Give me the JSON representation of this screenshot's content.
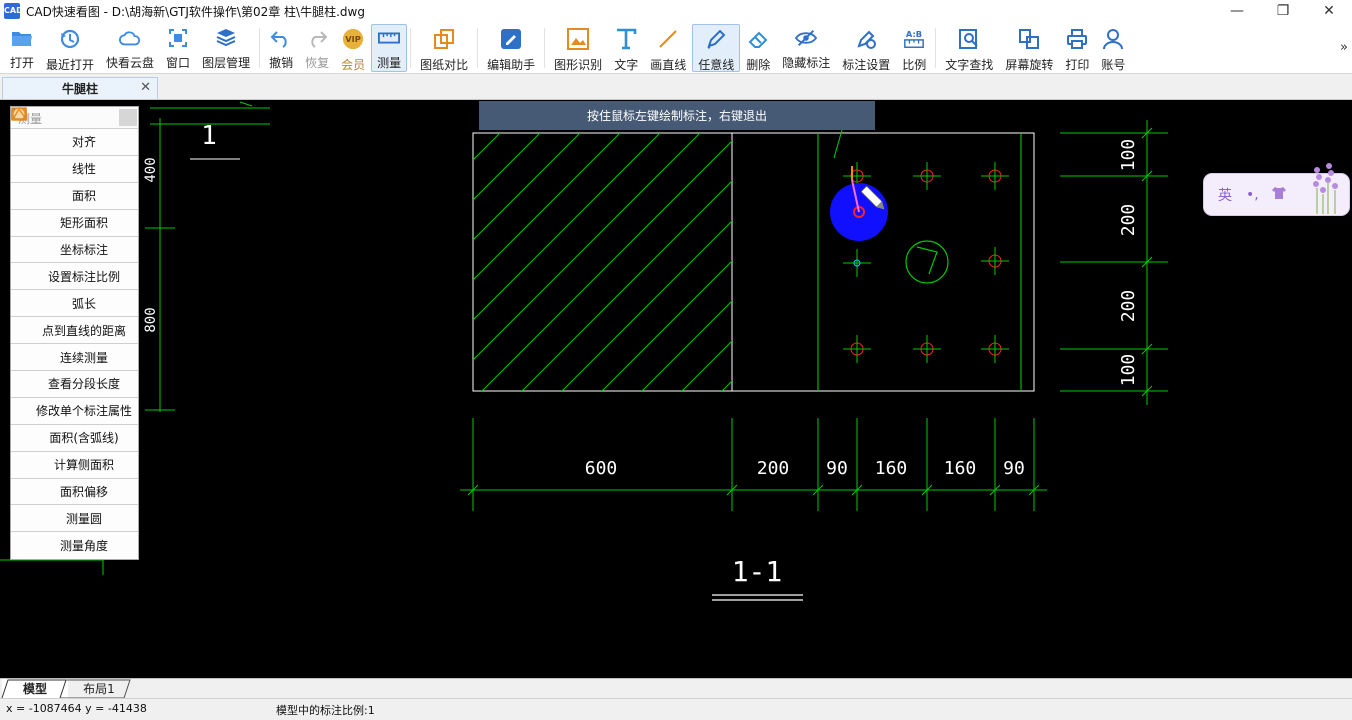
{
  "window": {
    "app_logo_text": "CAD",
    "title": "CAD快速看图 - D:\\胡海新\\GTJ软件操作\\第02章 柱\\牛腿柱.dwg",
    "minimize": "—",
    "maximize": "❐",
    "close": "✕"
  },
  "toolbar": {
    "open": "打开",
    "recent": "最近打开",
    "cloud": "快看云盘",
    "window": "窗口",
    "layers": "图层管理",
    "undo": "撤销",
    "redo": "恢复",
    "vip": "会员",
    "measure": "测量",
    "compare": "图纸对比",
    "edit_assistant": "编辑助手",
    "shape_recognize": "图形识别",
    "text": "文字",
    "line": "画直线",
    "freeline": "任意线",
    "delete": "删除",
    "hide_dim": "隐藏标注",
    "dim_settings": "标注设置",
    "ratio": "比例",
    "text_search": "文字查找",
    "rotate": "屏幕旋转",
    "print": "打印",
    "account": "账号",
    "more": "»"
  },
  "doc_tab": {
    "title": "牛腿柱",
    "close": "✕"
  },
  "banner": "按住鼠标左键绘制标注，右键退出",
  "panel": {
    "title": "测量",
    "items": [
      "对齐",
      "线性",
      "面积",
      "矩形面积",
      "坐标标注",
      "设置标注比例",
      "弧长",
      "点到直线的距离",
      "连续测量",
      "查看分段长度",
      "修改单个标注属性",
      "面积(含弧线)",
      "计算侧面积",
      "面积偏移",
      "测量圆",
      "测量角度"
    ]
  },
  "drawing": {
    "section_label_left": "1",
    "section_label_main": "1-1",
    "dims_bottom": [
      "600",
      "200",
      "90",
      "160",
      "160",
      "90"
    ],
    "dims_right": [
      "100",
      "200",
      "200",
      "100"
    ],
    "dims_left": [
      "400",
      "800"
    ]
  },
  "ime": {
    "lang": "英",
    "punct": "•,"
  },
  "layout_tabs": {
    "model": "模型",
    "layout1": "布局1"
  },
  "status": {
    "coords": "x = -1087464  y = -41438",
    "scale": "模型中的标注比例:1"
  },
  "colors": {
    "accent": "#2d6bd6",
    "cad_green": "#00ff00",
    "banner": "#465a75"
  }
}
